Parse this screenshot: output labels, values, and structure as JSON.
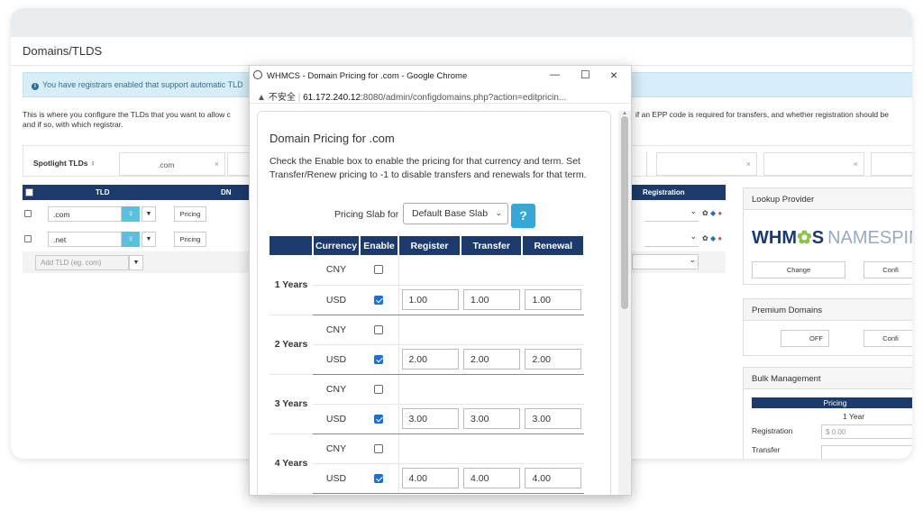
{
  "page": {
    "title": "Domains/TLDS",
    "alert": "You have registrars enabled that support automatic TLD",
    "description_left": "This is where you configure the TLDs that you want to allow c",
    "description_left2": "and if so, with which registrar.",
    "description_right": "if an EPP code is required for transfers, and whether registration should be",
    "spotlight_label": "Spotlight TLDs",
    "spotlight_value": ".com"
  },
  "tld_table": {
    "headers": {
      "tld": "TLD",
      "dns": "DN",
      "registration": "Registration"
    },
    "rows": [
      {
        "tld": ".com",
        "pricing_label": "Pricing"
      },
      {
        "tld": ".net",
        "pricing_label": "Pricing"
      }
    ],
    "add_placeholder": "Add TLD (eg. com)"
  },
  "right_panel": {
    "lookup_title": "Lookup Provider",
    "logo_bold": "WHM",
    "logo_mid": "S",
    "logo_light": "NAMESPIN",
    "change_label": "Change",
    "config_label": "Confi",
    "premium_title": "Premium Domains",
    "off_label": "OFF",
    "config_label2": "Confi",
    "bulk_title": "Bulk Management",
    "bulk_pricing": "Pricing",
    "bulk_year": "1 Year",
    "bulk_registration": "Registration",
    "bulk_transfer": "Transfer",
    "bulk_currency": "$",
    "bulk_value": "0.00"
  },
  "chrome": {
    "window_title": "WHMCS - Domain Pricing for .com - Google Chrome",
    "insecure_label": "不安全",
    "url_host": "61.172.240.12",
    "url_path": ":8080/admin/configdomains.php?action=editpricin..."
  },
  "dialog": {
    "title": "Domain Pricing for .com",
    "description": "Check the Enable box to enable the pricing for that currency and term. Set Transfer/Renew pricing to -1 to disable transfers and renewals for that term.",
    "slab_label": "Pricing Slab for",
    "slab_value": "Default Base Slab",
    "help_label": "?",
    "headers": {
      "currency": "Currency",
      "enable": "Enable",
      "register": "Register",
      "transfer": "Transfer",
      "renewal": "Renewal"
    },
    "terms": [
      {
        "label": "1 Years",
        "cny": "CNY",
        "usd": "USD",
        "register": "1.00",
        "transfer": "1.00",
        "renewal": "1.00"
      },
      {
        "label": "2 Years",
        "cny": "CNY",
        "usd": "USD",
        "register": "2.00",
        "transfer": "2.00",
        "renewal": "2.00"
      },
      {
        "label": "3 Years",
        "cny": "CNY",
        "usd": "USD",
        "register": "3.00",
        "transfer": "3.00",
        "renewal": "3.00"
      },
      {
        "label": "4 Years",
        "cny": "CNY",
        "usd": "USD",
        "register": "4.00",
        "transfer": "4.00",
        "renewal": "4.00"
      }
    ]
  }
}
